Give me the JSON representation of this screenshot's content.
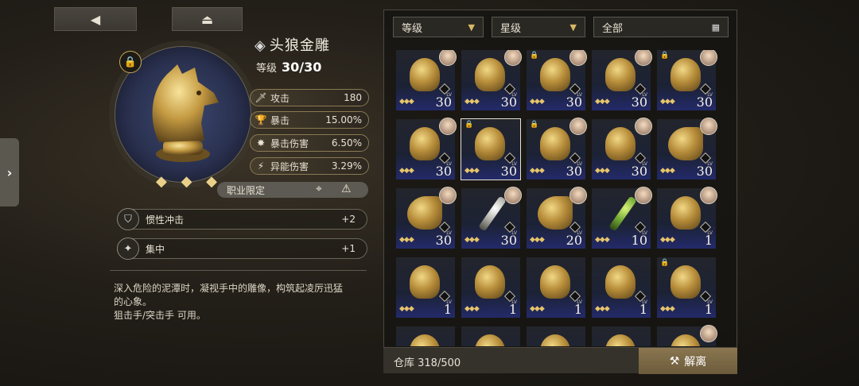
{
  "nav": {
    "back_icon": "◀",
    "stash_icon": "⏏",
    "side_arrow": "›"
  },
  "item": {
    "name": "头狼金雕",
    "level_label": "等级",
    "level_value": "30/30",
    "stars": "◆ ◆ ◆"
  },
  "stats": [
    {
      "icon": "sword-icon",
      "label": "攻击",
      "value": "180"
    },
    {
      "icon": "crit-icon",
      "label": "暴击",
      "value": "15.00%"
    },
    {
      "icon": "crit-damage-icon",
      "label": "暴击伤害",
      "value": "6.50%"
    },
    {
      "icon": "anomaly-icon",
      "label": "异能伤害",
      "value": "3.29%"
    }
  ],
  "restriction": {
    "label": "职业限定"
  },
  "skills": [
    {
      "label": "惯性冲击",
      "value": "+2"
    },
    {
      "label": "集中",
      "value": "+1"
    }
  ],
  "description": {
    "line1": "深入危险的泥潭时，凝视手中的雕像，构筑起凌厉迅猛",
    "line2": "的心象。",
    "line3": "狙击手/突击手 可用。"
  },
  "filters": {
    "level": "等级",
    "star": "星级",
    "all": "全部"
  },
  "cards": [
    {
      "lv": "30",
      "kind": "statue",
      "avatar": true,
      "lock": false
    },
    {
      "lv": "30",
      "kind": "statue",
      "avatar": true,
      "lock": false
    },
    {
      "lv": "30",
      "kind": "statue",
      "avatar": true,
      "lock": true
    },
    {
      "lv": "30",
      "kind": "statue",
      "avatar": true,
      "lock": false
    },
    {
      "lv": "30",
      "kind": "statue",
      "avatar": true,
      "lock": true
    },
    {
      "lv": "30",
      "kind": "statue",
      "avatar": true,
      "lock": false
    },
    {
      "lv": "30",
      "kind": "statue",
      "avatar": false,
      "lock": true,
      "selected": true
    },
    {
      "lv": "30",
      "kind": "statue",
      "avatar": true,
      "lock": true
    },
    {
      "lv": "30",
      "kind": "statue",
      "avatar": true,
      "lock": false
    },
    {
      "lv": "30",
      "kind": "wing",
      "avatar": true,
      "lock": false
    },
    {
      "lv": "30",
      "kind": "wing",
      "avatar": true,
      "lock": false
    },
    {
      "lv": "30",
      "kind": "keysilver",
      "avatar": true,
      "lock": false
    },
    {
      "lv": "20",
      "kind": "wing",
      "avatar": true,
      "lock": false
    },
    {
      "lv": "10",
      "kind": "keygreen",
      "avatar": true,
      "lock": false
    },
    {
      "lv": "1",
      "kind": "statue",
      "avatar": true,
      "lock": false
    },
    {
      "lv": "1",
      "kind": "statue",
      "avatar": false,
      "lock": false
    },
    {
      "lv": "1",
      "kind": "statue",
      "avatar": false,
      "lock": false
    },
    {
      "lv": "1",
      "kind": "statue",
      "avatar": false,
      "lock": false
    },
    {
      "lv": "1",
      "kind": "statue",
      "avatar": false,
      "lock": false
    },
    {
      "lv": "1",
      "kind": "statue",
      "avatar": false,
      "lock": true
    },
    {
      "lv": "",
      "kind": "statue",
      "avatar": false,
      "lock": false
    },
    {
      "lv": "",
      "kind": "statue",
      "avatar": false,
      "lock": false
    },
    {
      "lv": "",
      "kind": "statue",
      "avatar": false,
      "lock": false
    },
    {
      "lv": "",
      "kind": "statue",
      "avatar": false,
      "lock": false
    },
    {
      "lv": "",
      "kind": "statue",
      "avatar": true,
      "lock": false
    }
  ],
  "footer": {
    "capacity": "仓库 318/500",
    "dismantle": "解离"
  }
}
